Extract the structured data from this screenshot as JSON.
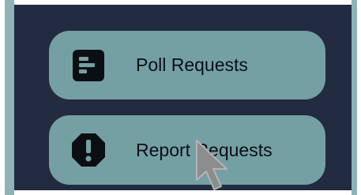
{
  "menu": {
    "items": [
      {
        "label": "Poll Requests",
        "icon": "poll-icon"
      },
      {
        "label": "Report Requests",
        "icon": "report-alert-icon"
      }
    ]
  },
  "colors": {
    "panel_background": "#222b40",
    "button_background": "#74a0a4",
    "frame": "#8fb3b5",
    "text": "#0b0f14",
    "cursor": "#8c8c8c"
  }
}
